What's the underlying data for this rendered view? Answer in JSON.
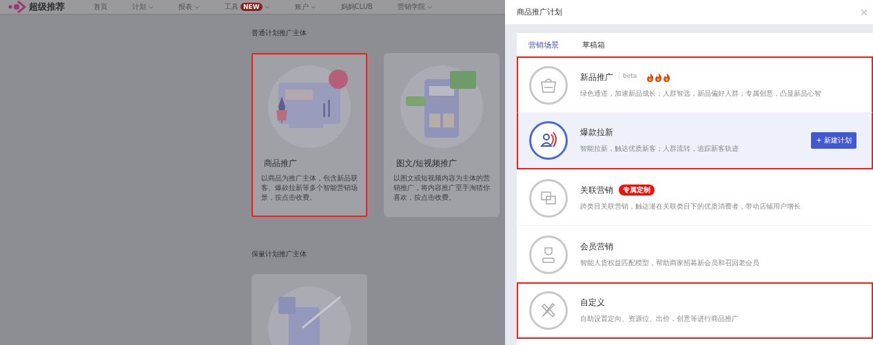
{
  "app": {
    "logo_text": "超级推荐"
  },
  "nav": [
    {
      "label": "首页",
      "dropdown": false
    },
    {
      "label": "计划",
      "dropdown": true
    },
    {
      "label": "报表",
      "dropdown": true
    },
    {
      "label": "工具",
      "dropdown": true,
      "badge": "NEW"
    },
    {
      "label": "账户",
      "dropdown": true
    },
    {
      "label": "妈妈CLUB",
      "dropdown": false
    },
    {
      "label": "营销学院",
      "dropdown": true
    }
  ],
  "sections": [
    {
      "title": "普通计划推广主体",
      "cards": [
        {
          "title": "商品推广",
          "description": "以商品为推广主体，包含新品获客、爆款拉新等多个智能营销场景，按点击收费。",
          "highlighted": true,
          "kind": "screen"
        },
        {
          "title": "图文/短视频推广",
          "description": "以图文或短视频内容为主体的营销推广，将内容推广至手淘猜你喜欢，按点击收费。",
          "highlighted": false,
          "kind": "phone"
        }
      ]
    },
    {
      "title": "保量计划推广主体",
      "cards": [
        {
          "highlighted": false,
          "kind": "growth"
        }
      ]
    }
  ],
  "drawer": {
    "title": "商品推广计划",
    "tabs": [
      {
        "label": "营销场景",
        "selected": true
      },
      {
        "label": "草稿箱",
        "selected": false
      }
    ],
    "scenarios": [
      {
        "kind": "new",
        "name": "新品推广",
        "badge": "beta",
        "hot": true,
        "description": "绿色通道，加速新品成长；人群智选，新品偏好人群；专属创意，凸显新品心智",
        "selected": false,
        "highlighted": true
      },
      {
        "kind": "users",
        "name": "爆款拉新",
        "hot": false,
        "description": "智能拉新，触达优质新客；人群流转，追踪新客轨迹",
        "selected": true,
        "highlighted": true,
        "button": "+ 新建计划"
      },
      {
        "kind": "link",
        "name": "关联营销",
        "hot": false,
        "tag": "专属定制",
        "description": "跨类目关联营销，触达潜在关联类目下的优质消费者，带动店铺用户增长",
        "selected": false,
        "highlighted": false
      },
      {
        "kind": "vip",
        "name": "会员营销",
        "hot": false,
        "description": "智能人货权益匹配模型，帮助商家招募新会员和召回老会员",
        "selected": false,
        "highlighted": false
      },
      {
        "kind": "custom",
        "name": "自定义",
        "hot": false,
        "description": "自助设置定向、资源位、出价，创意等进行商品推广",
        "selected": false,
        "highlighted": true
      }
    ]
  }
}
